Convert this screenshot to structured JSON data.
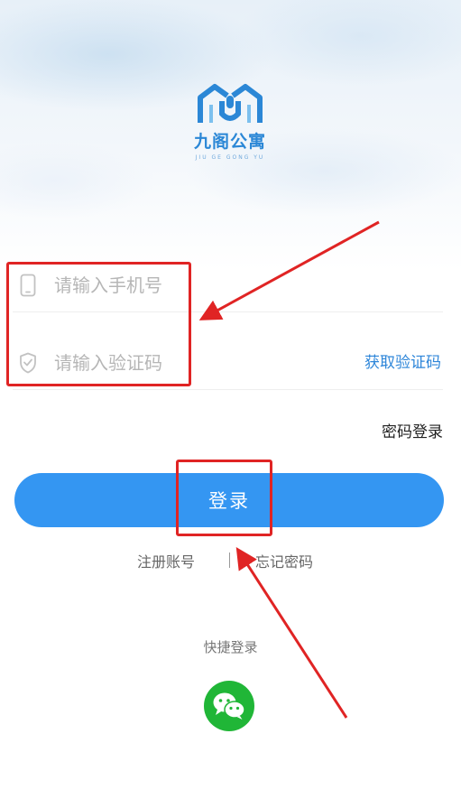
{
  "brand": {
    "name_cn": "九阁公寓",
    "name_pinyin": "JIU GE GONG YU",
    "color": "#2b87d6"
  },
  "form": {
    "phone_placeholder": "请输入手机号",
    "phone_icon": "phone-icon",
    "code_placeholder": "请输入验证码",
    "code_icon": "shield-check-icon",
    "get_code_label": "获取验证码",
    "password_login_label": "密码登录"
  },
  "login_button": {
    "label": "登录",
    "color": "#3496f2"
  },
  "links": {
    "register": "注册账号",
    "forgot_password": "忘记密码"
  },
  "quick_login": {
    "label": "快捷登录",
    "wechat_icon": "wechat-icon",
    "wechat_color": "#20b637"
  },
  "annotations": {
    "color": "#e02424"
  }
}
